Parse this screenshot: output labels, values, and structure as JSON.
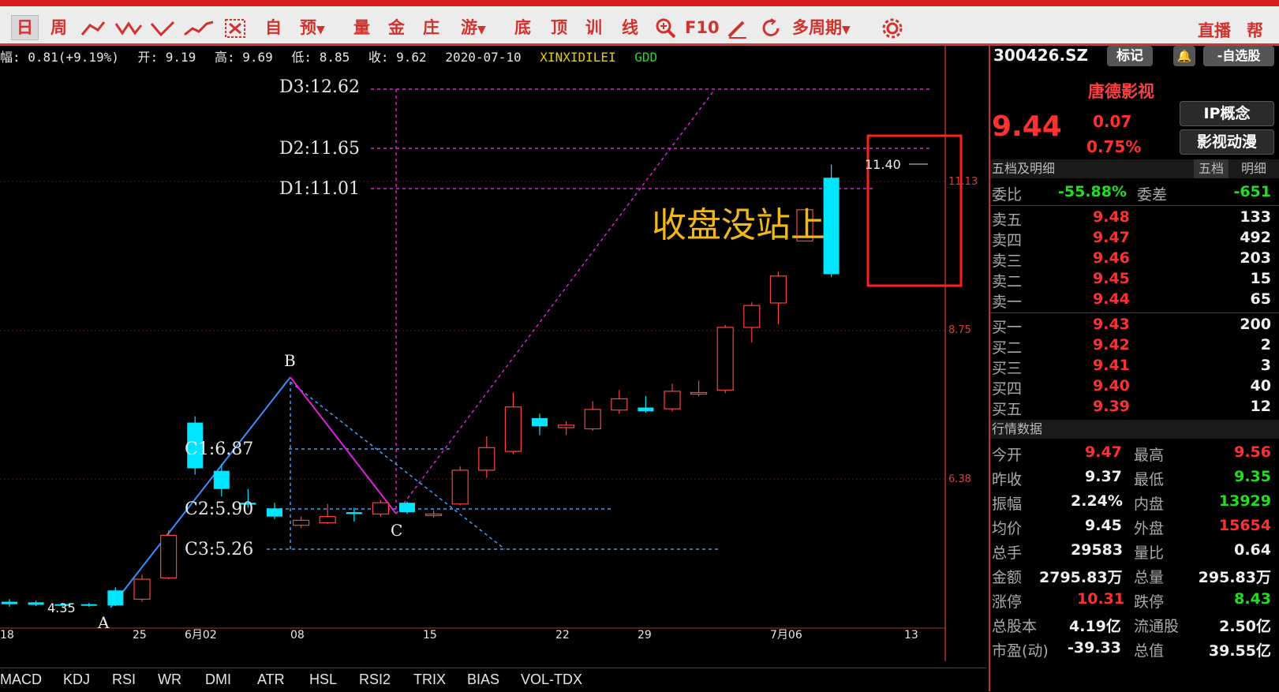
{
  "toolbar": {
    "day": "日",
    "week": "周",
    "zi": "自",
    "yu": "预",
    "liang": "量",
    "jin": "金",
    "zhuang": "庄",
    "you": "游",
    "di": "底",
    "ding": "顶",
    "xun": "训",
    "xian": "线",
    "f10": "F10",
    "multi": "多周期",
    "zhibo": "直播",
    "help": "帮助"
  },
  "info": {
    "change": "幅: 0.81(+9.19%)",
    "open": "开: 9.19",
    "high": "高: 9.69",
    "low": "低: 8.85",
    "close": "收: 9.62",
    "date": "2020-07-10",
    "ind1": "XINXIDILEI",
    "ind2": "GDD"
  },
  "chart": {
    "levels": {
      "d3": "D3:12.62",
      "d2": "D2:11.65",
      "d1": "D1:11.01",
      "c1": "C1:6.87",
      "c2": "C2:5.90",
      "c3": "C3:5.26"
    },
    "points": {
      "a": "A",
      "b": "B",
      "c": "C"
    },
    "low_label": "4.35",
    "high_label": "11.40",
    "annotation": "收盘没站上",
    "price_axis": [
      "11.13",
      "8.75",
      "6.38"
    ],
    "date_axis": [
      "18",
      "25",
      "6月02",
      "08",
      "15",
      "22",
      "29",
      "7月06",
      "13"
    ]
  },
  "indicators": [
    "MACD",
    "KDJ",
    "RSI",
    "WR",
    "DMI",
    "ATR",
    "HSL",
    "RSI2",
    "TRIX",
    "BIAS",
    "VOL-TDX"
  ],
  "colors": {
    "up": "#ff4040",
    "down": "#00e5ff",
    "accent": "#e03030"
  },
  "stock": {
    "code": "300426.SZ",
    "mark": "标记",
    "watch": "-自选股",
    "name": "唐德影视",
    "price": "9.44",
    "change": "0.07",
    "pct": "0.75%",
    "tag1": "IP概念",
    "tag2": "影视动漫"
  },
  "depth": {
    "title": "五档及明细",
    "tab1": "五档",
    "tab2": "明细",
    "weibi_label": "委比",
    "weibi": "-55.88%",
    "weicha_label": "委差",
    "weicha": "-651",
    "sells": [
      {
        "label": "卖五",
        "price": "9.48",
        "vol": "133"
      },
      {
        "label": "卖四",
        "price": "9.47",
        "vol": "492"
      },
      {
        "label": "卖三",
        "price": "9.46",
        "vol": "203"
      },
      {
        "label": "卖二",
        "price": "9.45",
        "vol": "15"
      },
      {
        "label": "卖一",
        "price": "9.44",
        "vol": "65"
      }
    ],
    "buys": [
      {
        "label": "买一",
        "price": "9.43",
        "vol": "200"
      },
      {
        "label": "买二",
        "price": "9.42",
        "vol": "2"
      },
      {
        "label": "买三",
        "price": "9.41",
        "vol": "3"
      },
      {
        "label": "买四",
        "price": "9.40",
        "vol": "40"
      },
      {
        "label": "买五",
        "price": "9.39",
        "vol": "12"
      }
    ]
  },
  "quote": {
    "title": "行情数据",
    "rows": [
      {
        "l1": "今开",
        "v1": "9.47",
        "l2": "最高",
        "v2": "9.56"
      },
      {
        "l1": "昨收",
        "v1": "9.37",
        "l2": "最低",
        "v2": "9.35"
      },
      {
        "l1": "振幅",
        "v1": "2.24%",
        "l2": "内盘",
        "v2": "13929"
      },
      {
        "l1": "均价",
        "v1": "9.45",
        "l2": "外盘",
        "v2": "15654"
      },
      {
        "l1": "总手",
        "v1": "29583",
        "l2": "量比",
        "v2": "0.64"
      },
      {
        "l1": "金额",
        "v1": "2795.83万",
        "l2": "总量",
        "v2": "295.83万"
      },
      {
        "l1": "涨停",
        "v1": "10.31",
        "l2": "跌停",
        "v2": "8.43"
      },
      {
        "l1": "总股本",
        "v1": "4.19亿",
        "l2": "流通股",
        "v2": "2.50亿"
      },
      {
        "l1": "市盈(动)",
        "v1": "-39.33",
        "l2": "总值",
        "v2": "39.55亿"
      }
    ]
  },
  "candles": [
    {
      "o": 4.42,
      "c": 4.38,
      "h": 4.46,
      "l": 4.34
    },
    {
      "o": 4.41,
      "c": 4.37,
      "h": 4.44,
      "l": 4.35
    },
    {
      "o": 4.38,
      "c": 4.36,
      "h": 4.4,
      "l": 4.33
    },
    {
      "o": 4.38,
      "c": 4.36,
      "h": 4.4,
      "l": 4.34
    },
    {
      "o": 4.6,
      "c": 4.36,
      "h": 4.65,
      "l": 4.35
    },
    {
      "o": 4.46,
      "c": 4.78,
      "h": 4.85,
      "l": 4.42
    },
    {
      "o": 4.8,
      "c": 5.48,
      "h": 5.56,
      "l": 4.78
    },
    {
      "o": 7.28,
      "c": 6.55,
      "h": 7.38,
      "l": 6.45
    },
    {
      "o": 6.51,
      "c": 6.22,
      "h": 6.62,
      "l": 6.1
    },
    {
      "o": 6.0,
      "c": 5.97,
      "h": 6.22,
      "l": 5.92
    },
    {
      "o": 5.91,
      "c": 5.78,
      "h": 6.0,
      "l": 5.74
    },
    {
      "o": 5.64,
      "c": 5.72,
      "h": 5.78,
      "l": 5.6
    },
    {
      "o": 5.68,
      "c": 5.78,
      "h": 5.98,
      "l": 5.66
    },
    {
      "o": 5.85,
      "c": 5.82,
      "h": 5.92,
      "l": 5.7
    },
    {
      "o": 5.82,
      "c": 6.0,
      "h": 6.04,
      "l": 5.78
    },
    {
      "o": 6.0,
      "c": 5.85,
      "h": 6.02,
      "l": 5.82
    },
    {
      "o": 5.8,
      "c": 5.82,
      "h": 5.88,
      "l": 5.76
    },
    {
      "o": 5.98,
      "c": 6.52,
      "h": 6.58,
      "l": 5.96
    },
    {
      "o": 6.52,
      "c": 6.88,
      "h": 7.06,
      "l": 6.4
    },
    {
      "o": 6.82,
      "c": 7.53,
      "h": 7.76,
      "l": 6.78
    },
    {
      "o": 7.35,
      "c": 7.22,
      "h": 7.42,
      "l": 7.08
    },
    {
      "o": 7.2,
      "c": 7.24,
      "h": 7.3,
      "l": 7.08
    },
    {
      "o": 7.18,
      "c": 7.49,
      "h": 7.62,
      "l": 7.15
    },
    {
      "o": 7.48,
      "c": 7.66,
      "h": 7.8,
      "l": 7.42
    },
    {
      "o": 7.52,
      "c": 7.46,
      "h": 7.7,
      "l": 7.44
    },
    {
      "o": 7.5,
      "c": 7.78,
      "h": 7.9,
      "l": 7.46
    },
    {
      "o": 7.74,
      "c": 7.76,
      "h": 7.95,
      "l": 7.7
    },
    {
      "o": 7.8,
      "c": 8.8,
      "h": 8.84,
      "l": 7.75
    },
    {
      "o": 8.8,
      "c": 9.15,
      "h": 9.2,
      "l": 8.56
    },
    {
      "o": 9.19,
      "c": 9.62,
      "h": 9.69,
      "l": 8.85
    },
    {
      "o": 10.18,
      "c": 10.68,
      "h": 10.68,
      "l": 10.17
    },
    {
      "o": 11.19,
      "c": 9.65,
      "h": 11.4,
      "l": 9.6
    }
  ]
}
